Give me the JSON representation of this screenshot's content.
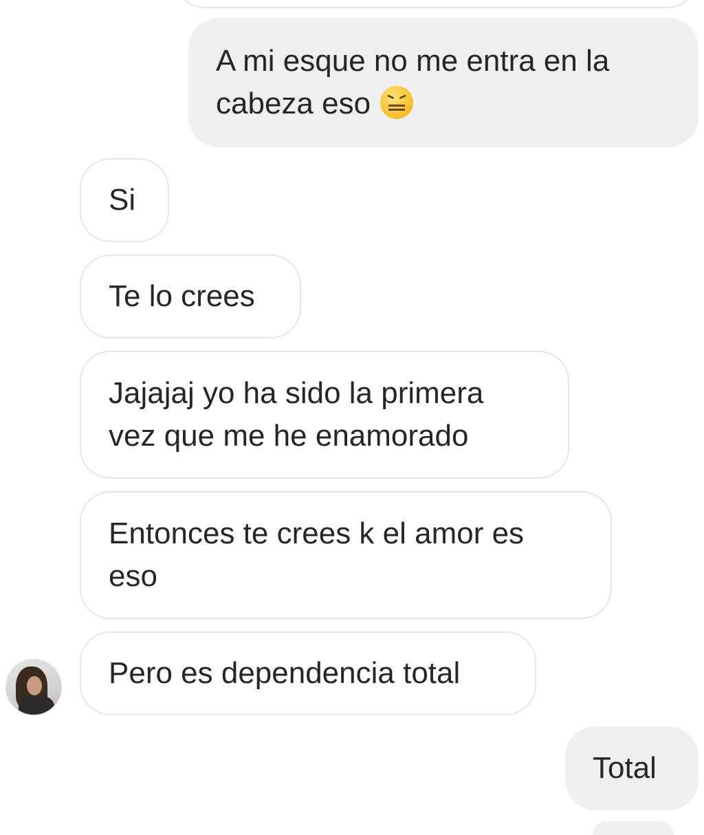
{
  "messages": {
    "sent_1": {
      "text": "A mi esque no me entra en la\ncabeza eso",
      "emoji": "confounded-face-emoji"
    },
    "received_1": {
      "text": "Si"
    },
    "received_2": {
      "text": "Te lo crees"
    },
    "received_3": {
      "text": "Jajajaj yo ha sido la primera\nvez que me he enamorado"
    },
    "received_4": {
      "text": "Entonces te crees k el amor es\neso"
    },
    "received_5": {
      "text": "Pero es dependencia total"
    },
    "sent_2": {
      "text": "Total"
    }
  },
  "colors": {
    "sent_bubble": "#efefef",
    "received_border": "#e6e6e6",
    "text": "#262626"
  }
}
